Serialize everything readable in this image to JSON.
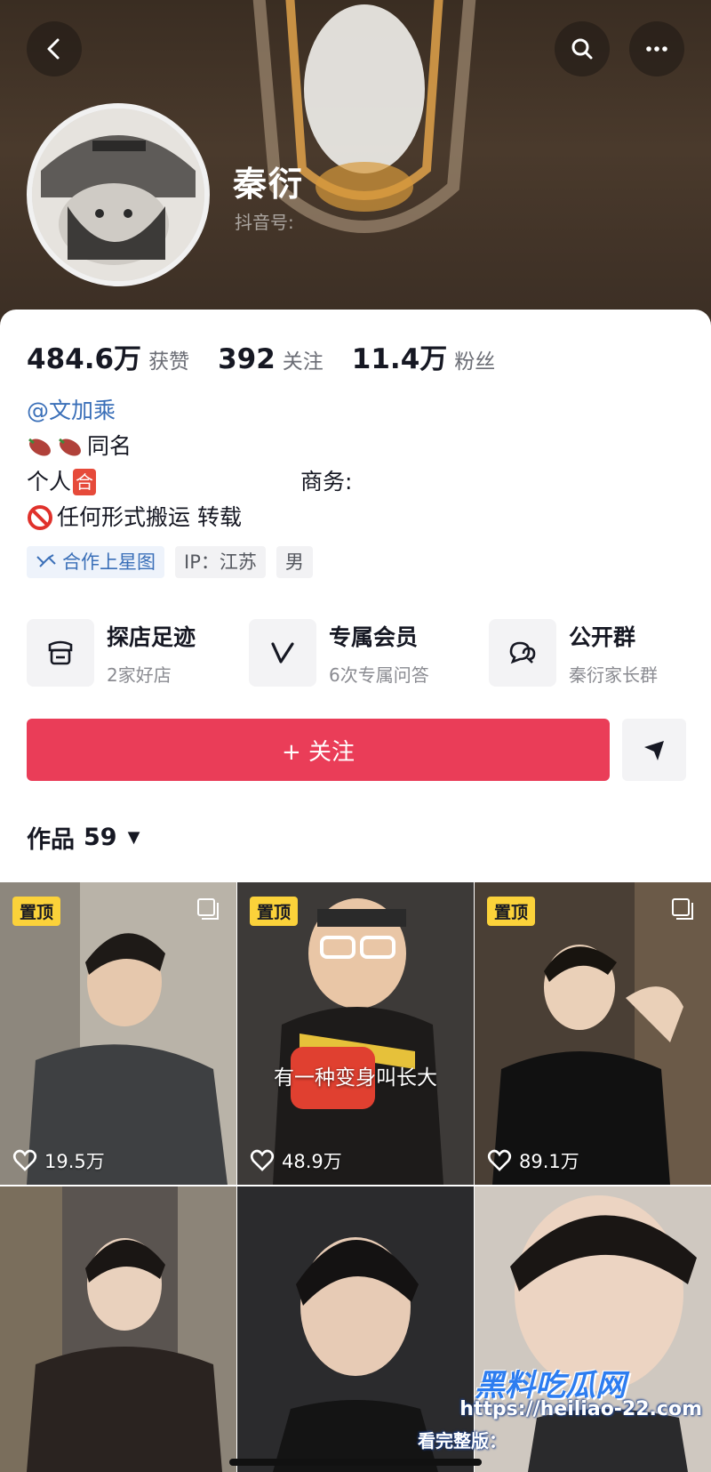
{
  "header": {
    "nickname": "秦衍",
    "account_id_label": "抖音号:"
  },
  "stats": [
    {
      "value": "484.6万",
      "label": "获赞"
    },
    {
      "value": "392",
      "label": "关注"
    },
    {
      "value": "11.4万",
      "label": "粉丝"
    }
  ],
  "bio": {
    "mention": "@文加乘",
    "same_name": "同名",
    "personal": "个人",
    "personal_badge": "合",
    "business": "商务:",
    "notice": "任何形式搬运 转载"
  },
  "tags": {
    "star": "合作上星图",
    "ip": "IP：江苏",
    "gender": "男"
  },
  "services": [
    {
      "title": "探店足迹",
      "sub": "2家好店",
      "icon": "store-icon"
    },
    {
      "title": "专属会员",
      "sub": "6次专属问答",
      "icon": "member-v-icon"
    },
    {
      "title": "公开群",
      "sub": "秦衍家长群",
      "icon": "group-chat-icon"
    }
  ],
  "actions": {
    "follow": "+ 关注"
  },
  "works": {
    "label": "作品",
    "count": "59",
    "caret": "▼"
  },
  "grid": [
    {
      "pinned": "置顶",
      "likes": "19.5万",
      "caption": ""
    },
    {
      "pinned": "置顶",
      "likes": "48.9万",
      "caption": "有一种变身叫长大"
    },
    {
      "pinned": "置顶",
      "likes": "89.1万",
      "caption": ""
    },
    {
      "pinned": "",
      "likes": "",
      "caption": ""
    },
    {
      "pinned": "",
      "likes": "",
      "caption": ""
    },
    {
      "pinned": "",
      "likes": "",
      "caption": ""
    }
  ],
  "watermark": {
    "brand": "黑料吃瓜网",
    "label": "看完整版：",
    "url": "https://heiliao-22.com"
  },
  "colors": {
    "follow_button": "#ea3d58",
    "pin_badge": "#fbd23a",
    "mention": "#3a6fb8"
  }
}
